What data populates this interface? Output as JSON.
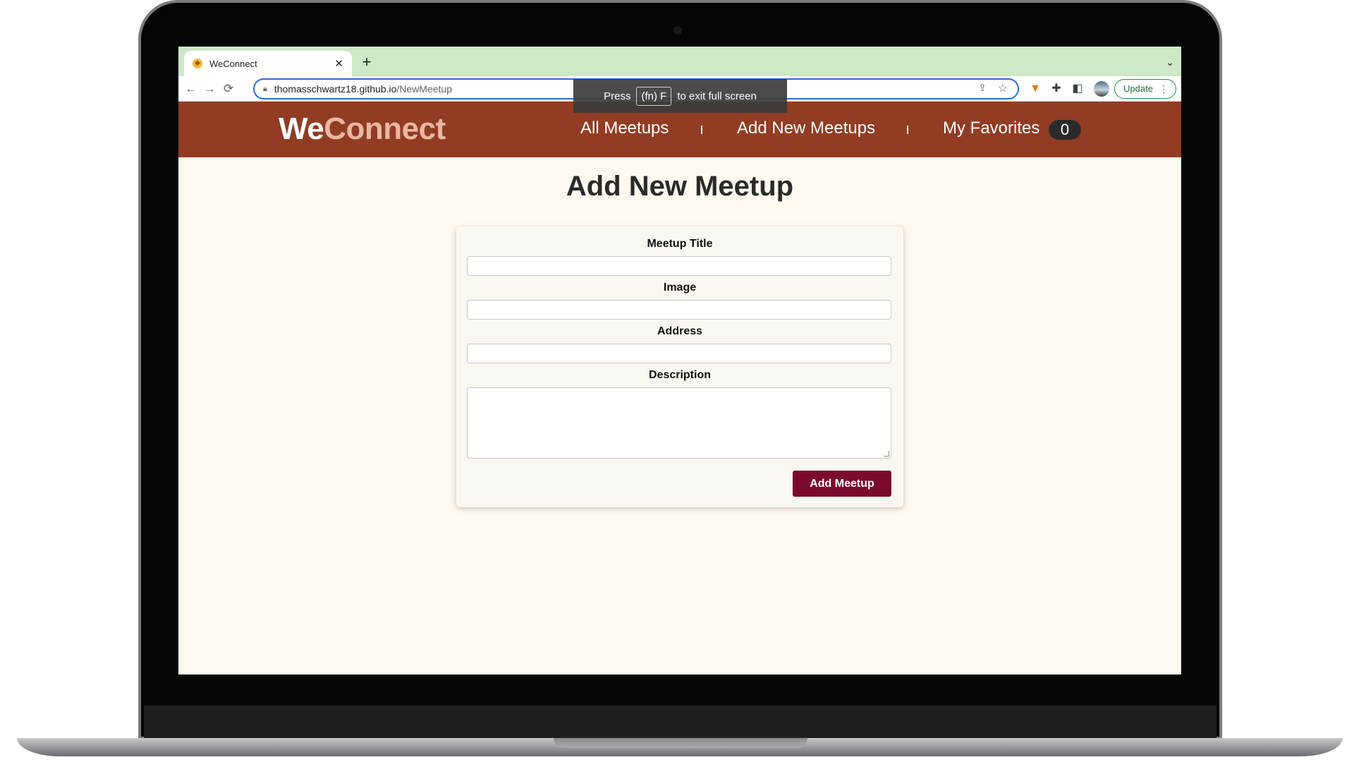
{
  "browser": {
    "tab_title": "WeConnect",
    "tab_close": "✕",
    "new_tab": "+",
    "tab_menu": "⌄",
    "back": "←",
    "forward": "→",
    "reload": "⟳",
    "url_host": "thomasschwartz18.github.io",
    "url_path": "/NewMeetup",
    "update_label": "Update",
    "update_menu": "⋮"
  },
  "toast": {
    "prefix": "Press",
    "key": "(fn) F",
    "suffix": "to exit full screen"
  },
  "site": {
    "logo_we": "We",
    "logo_connect": "Connect",
    "nav": {
      "all_meetups": "All Meetups",
      "add_new": "Add New Meetups",
      "favorites": "My Favorites",
      "favorites_count": "0"
    }
  },
  "form": {
    "page_title": "Add New Meetup",
    "title_label": "Meetup Title",
    "title_value": "",
    "image_label": "Image",
    "image_value": "",
    "address_label": "Address",
    "address_value": "",
    "description_label": "Description",
    "description_value": "",
    "submit_label": "Add Meetup"
  },
  "colors": {
    "header_bg": "#923c23",
    "page_bg": "#fef9ef",
    "button_bg": "#7c0a2e",
    "tabstrip_bg": "#cde8c6"
  }
}
